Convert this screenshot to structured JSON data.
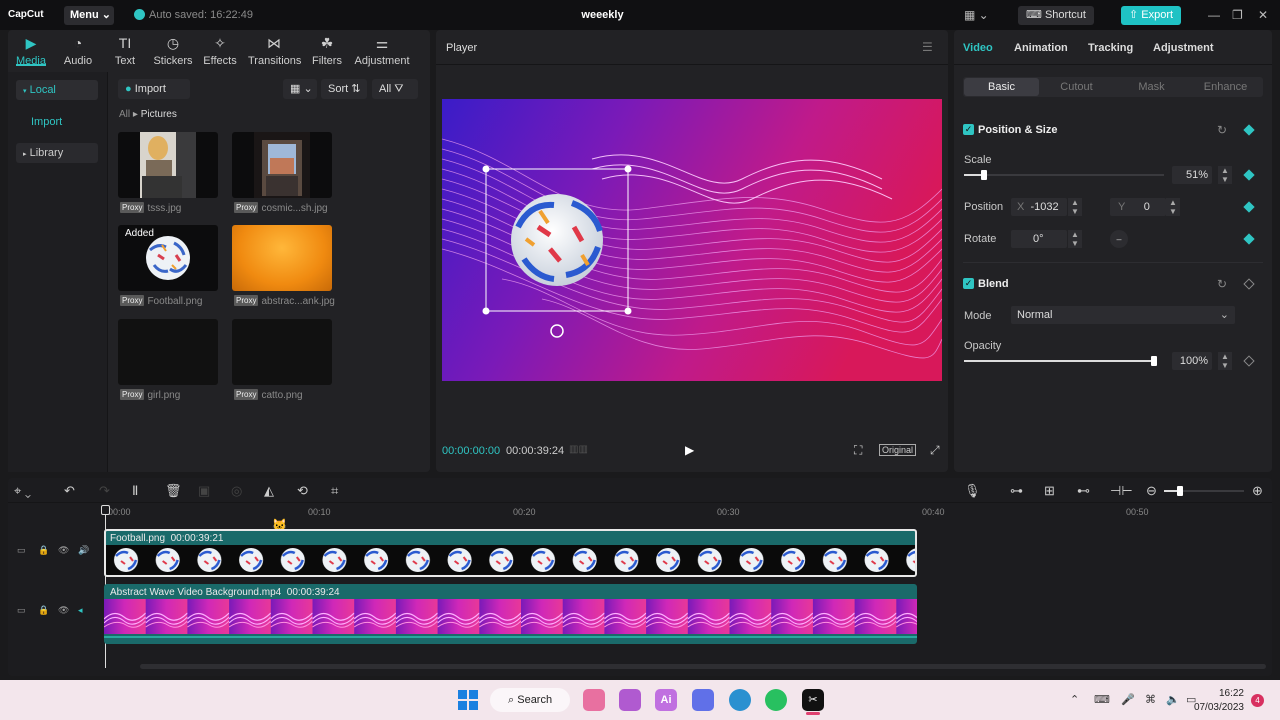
{
  "app": {
    "logo": "CapCut",
    "menu": "Menu",
    "autosave": "Auto saved: 16:22:49",
    "project_title": "weeekly",
    "shortcut": "Shortcut",
    "export": "Export"
  },
  "toolbar": {
    "tabs": [
      {
        "label": "Media",
        "icon": "media-icon"
      },
      {
        "label": "Audio",
        "icon": "audio-icon"
      },
      {
        "label": "Text",
        "icon": "text-icon"
      },
      {
        "label": "Stickers",
        "icon": "stickers-icon"
      },
      {
        "label": "Effects",
        "icon": "effects-icon"
      },
      {
        "label": "Transitions",
        "icon": "transitions-icon"
      },
      {
        "label": "Filters",
        "icon": "filters-icon"
      },
      {
        "label": "Adjustment",
        "icon": "adjustment-icon"
      }
    ]
  },
  "sidebar": {
    "local": "Local",
    "import": "Import",
    "library": "Library"
  },
  "media": {
    "import_btn": "Import",
    "sort": "Sort",
    "filter": "All",
    "breadcrumb_root": "All",
    "breadcrumb_current": "Pictures",
    "proxy": "Proxy",
    "added": "Added",
    "files": [
      "tsss.jpg",
      "cosmic...sh.jpg",
      "Football.png",
      "abstrac...ank.jpg",
      "girl.png",
      "catto.png"
    ]
  },
  "player": {
    "title": "Player",
    "current_time": "00:00:00:00",
    "total_time": "00:00:39:24",
    "ratio": "Original"
  },
  "inspector": {
    "tabs": [
      "Video",
      "Animation",
      "Tracking",
      "Adjustment"
    ],
    "subtabs": [
      "Basic",
      "Cutout",
      "Mask",
      "Enhance"
    ],
    "position_size": "Position & Size",
    "scale_label": "Scale",
    "scale_value": "51%",
    "position_label": "Position",
    "x_label": "X",
    "x_value": "-1032",
    "y_label": "Y",
    "y_value": "0",
    "rotate_label": "Rotate",
    "rotate_value": "0°",
    "blend": "Blend",
    "mode_label": "Mode",
    "mode_value": "Normal",
    "opacity_label": "Opacity",
    "opacity_value": "100%",
    "scale_fraction": 0.51,
    "opacity_fraction": 1.0,
    "accent": "#2fc5c3"
  },
  "timeline": {
    "ruler": [
      "00:00",
      "00:10",
      "00:20",
      "00:30",
      "00:40",
      "00:50"
    ],
    "clip1": {
      "name": "Football.png",
      "duration": "00:00:39:21"
    },
    "clip2": {
      "name": "Abstract Wave Video Background.mp4",
      "duration": "00:00:39:24"
    }
  },
  "taskbar": {
    "search": "Search",
    "time": "16:22",
    "date": "07/03/2023",
    "notifications": "4"
  }
}
